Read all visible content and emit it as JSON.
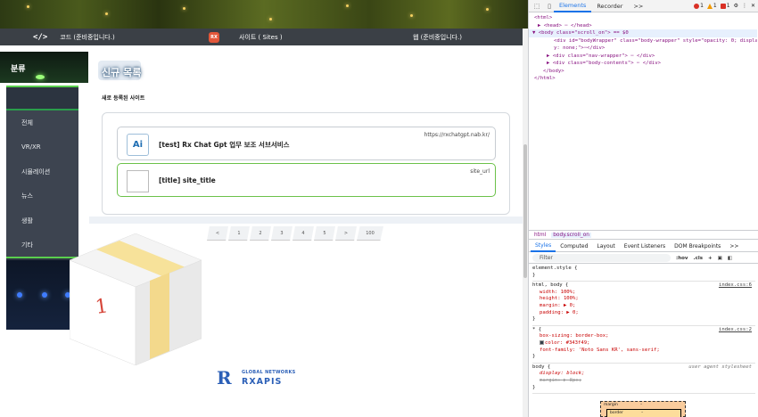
{
  "topnav": {
    "code_label": "코드 (준비중입니다.)",
    "code_icon": "code-icon",
    "sites_label": "사이트 ( Sites )",
    "sites_icon_text": "RX",
    "web_label": "웹 (준비중입니다.)"
  },
  "sidebar": {
    "title": "분류",
    "items": [
      "전체",
      "VR/XR",
      "시뮬레이션",
      "뉴스",
      "생활",
      "기타"
    ]
  },
  "main": {
    "heading": "신규 목록",
    "subtitle": "새로 등록된 사이트",
    "cards": [
      {
        "title": "[test] Rx Chat Gpt 업무 보조 서브서비스",
        "url": "https://rxchatgpt.nab.kr/",
        "thumb_text": "Ai"
      },
      {
        "title": "[title] site_title",
        "url": "site_url"
      }
    ],
    "pagination": [
      "<",
      "1",
      "2",
      "3",
      "4",
      "5",
      ">",
      "100"
    ],
    "box_number": "1"
  },
  "logo": {
    "line1": "GLOBAL NETWORKS",
    "line2": "RXAPIS",
    "mark": "R"
  },
  "devtools": {
    "tabs": [
      "Elements",
      "Recorder",
      ">>"
    ],
    "badges": {
      "errors": "1",
      "warnings": "1",
      "issues": "1"
    },
    "dom": [
      "<html>",
      "▶ <head> ⋯ </head>",
      "▼ <body class=\"scroll_on\"> == $0",
      "<div id=\"bodyWrapper\" class=\"body-wrapper\" style=\"opacity: 0; displa",
      "y: none;\">⋯</div>",
      "▶ <div class=\"nav-wrapper\"> ⋯ </div>",
      "▶ <div class=\"body-contents\"> ⋯ </div>",
      "</body>",
      "</html>"
    ],
    "crumbs": {
      "first": "html",
      "current": "body.scroll_on"
    },
    "panel_tabs": [
      "Styles",
      "Computed",
      "Layout",
      "Event Listeners",
      "DOM Breakpoints",
      ">>"
    ],
    "filter_placeholder": "Filter",
    "filter_actions": [
      ":hov",
      ".cls",
      "+"
    ],
    "rules": {
      "element_style": "element.style {",
      "rule1_selector": "html, body {",
      "rule1_src": "index.css:6",
      "rule1_props": [
        "width: 100%;",
        "height: 100%;",
        "margin: ▶ 0;",
        "padding: ▶ 0;"
      ],
      "rule2_selector": "* {",
      "rule2_src": "index.css:2",
      "rule2_props": [
        "box-sizing: border-box;",
        "color: #343f49;",
        "font-family: 'Noto Sans KR', sans-serif;"
      ],
      "rule3_selector": "body {",
      "rule3_src": "user agent stylesheet",
      "rule3_props": [
        "display: block;",
        "margin: ▶ 8px;"
      ],
      "close": "}"
    },
    "boxmodel": {
      "margin": "margin",
      "border": "border",
      "dash": "–"
    }
  }
}
